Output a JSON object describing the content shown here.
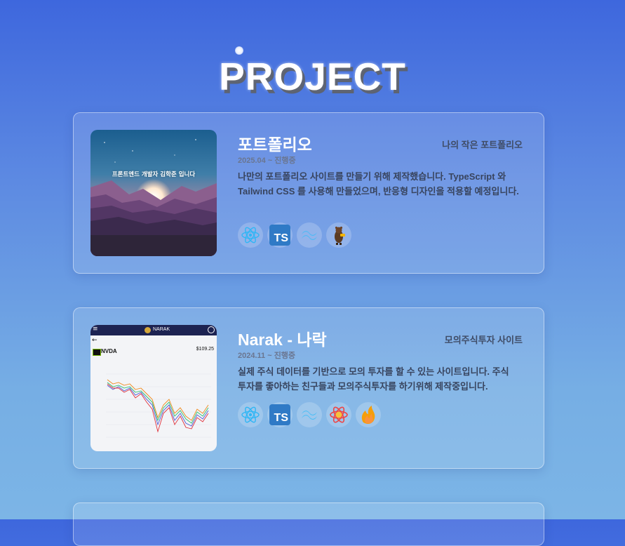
{
  "page": {
    "title": "PROJECT"
  },
  "projects": [
    {
      "name": "포트폴리오",
      "subtitle": "나의 작은 포트폴리오",
      "period": "2025.04 ~ 진행중",
      "description": "나만의 포트폴리오 사이트를 만들기 위해 제작했습니다. TypeScript 와 Tailwind CSS 를 사용해 만들었으며, 반응형 디자인을 적용할 예정입니다.",
      "thumbnail_caption": "프론트엔드 개발자 김학준 입니다",
      "tech_icons": [
        "react-icon",
        "typescript-icon",
        "tailwind-icon",
        "zustand-icon"
      ],
      "tech_labels": {
        "typescript": "TS"
      }
    },
    {
      "name": "Narak - 나락",
      "subtitle": "모의주식투자 사이트",
      "period": "2024.11 ~ 진행중",
      "description": "실제 주식 데이터를 기반으로 모의 투자를 할 수 있는 사이트입니다. 주식 투자를 좋아하는 친구들과 모의주식투자를 하기위해 제작중입니다.",
      "thumbnail": {
        "app_name": "NARAK",
        "ticker": "NVDA",
        "price": "$109.25"
      },
      "tech_icons": [
        "react-icon",
        "typescript-icon",
        "tailwind-icon",
        "react-query-icon",
        "firebase-icon"
      ],
      "tech_labels": {
        "typescript": "TS"
      }
    }
  ],
  "colors": {
    "react": "#2fb6f5",
    "typescript": "#2f7ac6",
    "tailwind": "#38bdf8",
    "react_query": "#ef4444",
    "firebase": "#f59e0b"
  }
}
